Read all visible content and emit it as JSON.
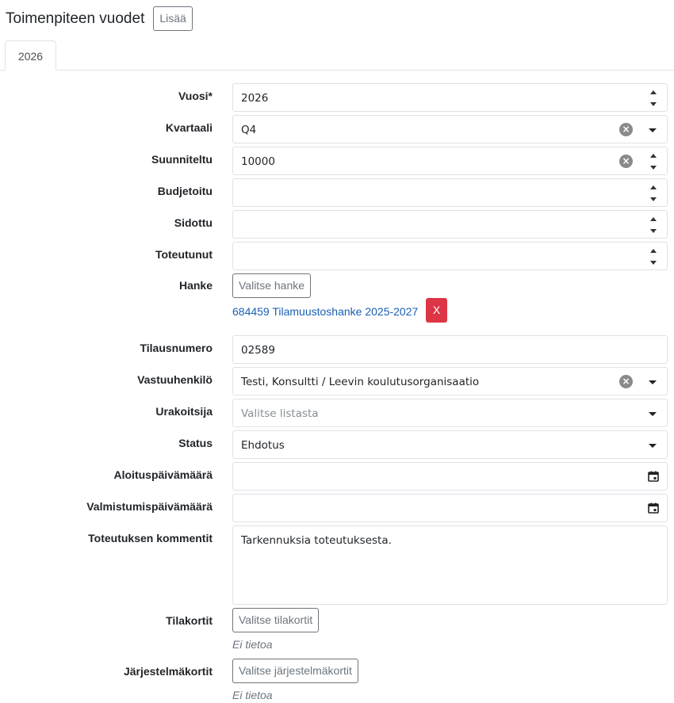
{
  "header": {
    "title": "Toimenpiteen vuodet",
    "add_label": "Lisää"
  },
  "tabs": [
    {
      "label": "2026",
      "active": true
    }
  ],
  "form": {
    "year": {
      "label": "Vuosi*",
      "value": "2026"
    },
    "quarter": {
      "label": "Kvartaali",
      "value": "Q4"
    },
    "planned": {
      "label": "Suunniteltu",
      "value": "10000"
    },
    "budgeted": {
      "label": "Budjetoitu",
      "value": ""
    },
    "committed": {
      "label": "Sidottu",
      "value": ""
    },
    "realized": {
      "label": "Toteutunut",
      "value": ""
    },
    "project": {
      "label": "Hanke",
      "button_label": "Valitse hanke",
      "selected": "684459 Tilamuustoshanke 2025-2027",
      "remove_label": "X"
    },
    "order_number": {
      "label": "Tilausnumero",
      "value": "02589"
    },
    "responsible": {
      "label": "Vastuuhenkilö",
      "value": "Testi, Konsultti / Leevin koulutusorganisaatio"
    },
    "contractor": {
      "label": "Urakoitsija",
      "placeholder": "Valitse listasta"
    },
    "status": {
      "label": "Status",
      "value": "Ehdotus"
    },
    "start_date": {
      "label": "Aloituspäivämäärä",
      "value": ""
    },
    "end_date": {
      "label": "Valmistumispäivämäärä",
      "value": ""
    },
    "comments": {
      "label": "Toteutuksen kommentit",
      "value": "Tarkennuksia toteutuksesta."
    },
    "space_cards": {
      "label": "Tilakortit",
      "button_label": "Valitse tilakortit",
      "empty": "Ei tietoa"
    },
    "system_cards": {
      "label": "Järjestelmäkortit",
      "button_label": "Valitse järjestelmäkortit",
      "empty": "Ei tietoa"
    }
  },
  "colors": {
    "danger": "#dc3545",
    "link": "#1a5fb4",
    "border": "#dee2e6"
  }
}
